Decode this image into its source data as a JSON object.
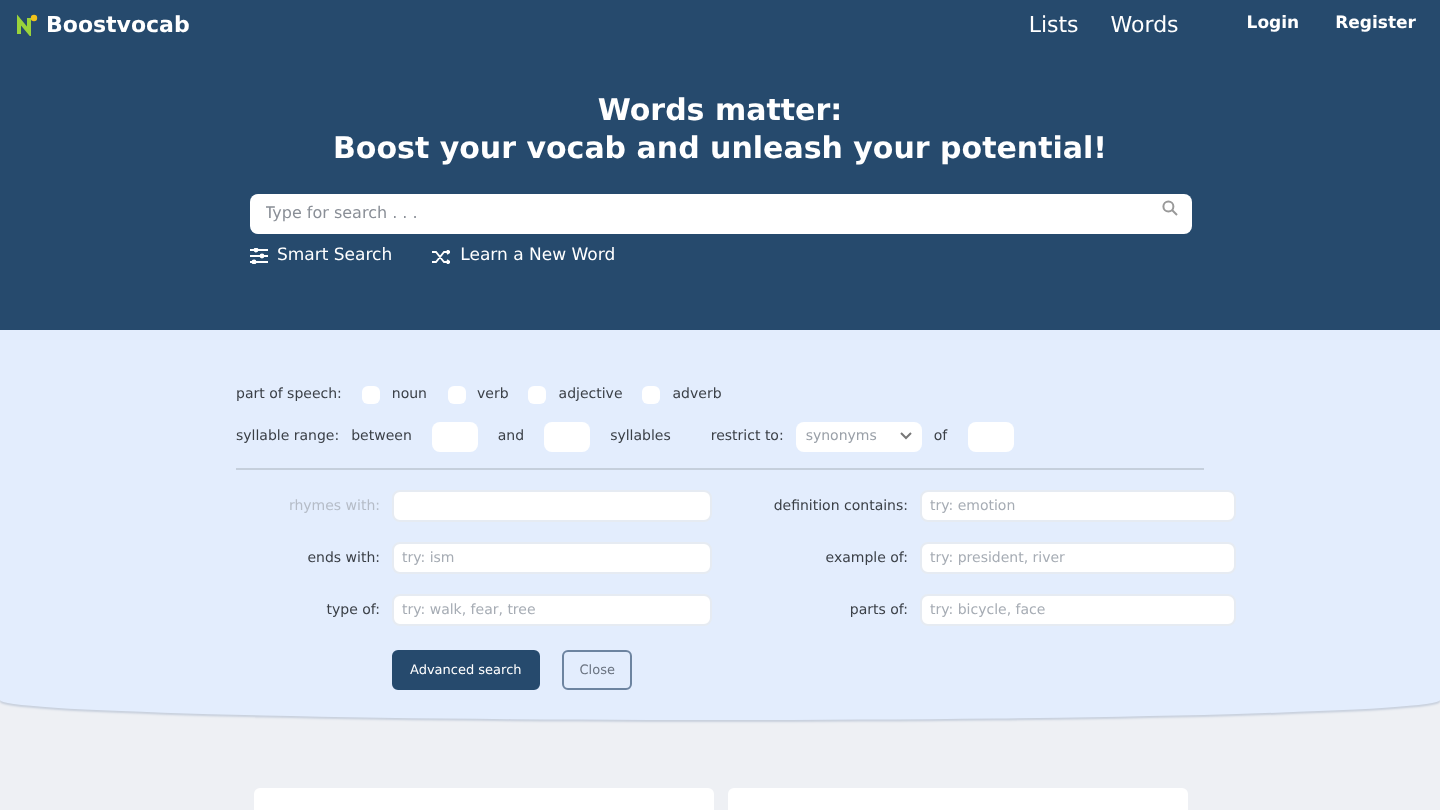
{
  "brand": {
    "name": "Boostvocab"
  },
  "nav": [
    "Lists",
    "Words"
  ],
  "auth": [
    "Login",
    "Register"
  ],
  "hero": {
    "title_line_1": "Words matter:",
    "title_line_2": "Boost your vocab and unleash your potential!"
  },
  "search": {
    "placeholder": "Type for search . . ."
  },
  "actions": [
    {
      "kind": "filter",
      "label": "Smart Search"
    },
    {
      "kind": "shuffle",
      "label": "Learn a New Word"
    }
  ],
  "part_of_speech": {
    "label": "part of speech:",
    "options": [
      {
        "label": "noun",
        "checked": false
      },
      {
        "label": "verb",
        "checked": false
      },
      {
        "label": "adjective",
        "checked": false
      },
      {
        "label": "adverb",
        "checked": false
      }
    ]
  },
  "syllables": {
    "label": "syllable range:",
    "between": "between",
    "and": "and",
    "unit": "syllables"
  },
  "restrict": {
    "label": "restrict to:",
    "value": "synonyms",
    "of": "of"
  },
  "fields": [
    {
      "label": "rhymes with:",
      "disabled": true
    },
    {
      "label": "definition contains:",
      "placeholder": "try: emotion",
      "disabled": false
    },
    {
      "label": "ends with:",
      "placeholder": "try: ism",
      "disabled": false
    },
    {
      "label": "example of:",
      "placeholder": "try: president, river",
      "disabled": false
    },
    {
      "label": "type of:",
      "placeholder": "try: walk, fear, tree",
      "disabled": false
    },
    {
      "label": "parts of:",
      "placeholder": "try: bicycle, face",
      "disabled": false
    }
  ],
  "buttons": [
    {
      "kind": "primary",
      "label": "Advanced search"
    },
    {
      "kind": "secondary",
      "label": "Close"
    }
  ]
}
